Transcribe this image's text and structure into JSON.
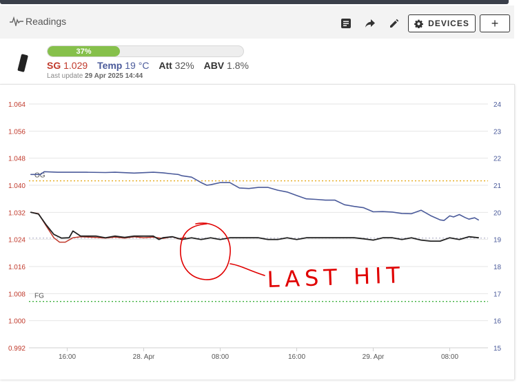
{
  "header": {
    "title": "Readings",
    "devices_label": "DEVICES",
    "add_label": "+",
    "icons": [
      "pulse-icon",
      "notes-icon",
      "share-icon",
      "edit-icon",
      "gear-icon"
    ]
  },
  "device": {
    "progress_label": "37%",
    "progress_fraction": 0.37,
    "sg_label": "SG",
    "sg_value": "1.029",
    "temp_label": "Temp",
    "temp_value": "19 °C",
    "att_label": "Att",
    "att_value": "32%",
    "abv_label": "ABV",
    "abv_value": "1.8%",
    "last_update_label": "Last update",
    "last_update_value": "29 Apr 2025 14:44"
  },
  "colors": {
    "sg": "#c0392b",
    "temp": "#4a5a9a",
    "sg_smoothed": "#222222",
    "og_line": "#e6a817",
    "fg_line": "#3ab03a",
    "current_line": "#b0b0c8",
    "progress": "#86c04b",
    "annotation": "#e00000"
  },
  "chart_data": {
    "type": "line",
    "x_ticks": [
      "16:00",
      "28. Apr",
      "08:00",
      "16:00",
      "29. Apr",
      "08:00"
    ],
    "y_left_ticks": [
      "1.064",
      "1.056",
      "1.048",
      "1.040",
      "1.032",
      "1.024",
      "1.016",
      "1.008",
      "1.000",
      "0.992"
    ],
    "y_right_ticks": [
      "24",
      "23",
      "22",
      "21",
      "20",
      "19",
      "18",
      "17",
      "16",
      "15"
    ],
    "y_left_range": [
      0.992,
      1.064
    ],
    "y_right_range": [
      15,
      24
    ],
    "x_range_hours": [
      -3,
      45
    ],
    "grid": true,
    "og": {
      "label": "OG",
      "value": 1.0413
    },
    "fg": {
      "label": "FG",
      "value": 1.0057
    },
    "current_sg": 1.0244,
    "annotation_text": "LAST HIT",
    "series": [
      {
        "key": "temp",
        "x": [
          -2.8,
          -1.8,
          -1.4,
          0,
          1,
          3,
          5,
          6,
          8,
          10,
          11,
          12,
          12.6,
          13,
          14,
          15,
          15.6,
          16,
          17,
          18,
          19,
          20,
          21,
          22,
          23,
          24,
          25,
          26,
          27,
          28,
          29,
          30,
          31,
          32,
          33,
          34,
          35,
          36,
          37,
          38,
          39,
          40,
          40.4,
          41,
          41.4,
          42,
          42.6,
          43,
          43.6,
          44
        ],
        "y": [
          21.4,
          21.4,
          21.5,
          21.48,
          21.48,
          21.48,
          21.47,
          21.48,
          21.45,
          21.48,
          21.46,
          21.42,
          21.4,
          21.35,
          21.3,
          21.1,
          21.0,
          21.02,
          21.1,
          21.1,
          20.9,
          20.88,
          20.92,
          20.92,
          20.82,
          20.75,
          20.62,
          20.5,
          20.48,
          20.45,
          20.45,
          20.28,
          20.22,
          20.17,
          20.02,
          20.03,
          20.01,
          19.96,
          19.95,
          20.08,
          19.88,
          19.72,
          19.7,
          19.87,
          19.83,
          19.92,
          19.81,
          19.75,
          19.8,
          19.72
        ]
      },
      {
        "key": "sg",
        "x": [
          -2.8,
          -2,
          -1.2,
          -0.4,
          0.2,
          0.8,
          1.6,
          2.4,
          3.2,
          4,
          5,
          6,
          7,
          8,
          9,
          10,
          11,
          12,
          12.6,
          13.4
        ],
        "y": [
          1.032,
          1.0316,
          1.028,
          1.0245,
          1.0232,
          1.0232,
          1.0245,
          1.0248,
          1.0247,
          1.0246,
          1.0244,
          1.0247,
          1.0244,
          1.0248,
          1.0245,
          1.0247,
          1.0243,
          1.0248,
          1.0242,
          1.0246
        ]
      },
      {
        "key": "sg_smoothed",
        "x": [
          -2.8,
          -2,
          -1.2,
          -0.4,
          0.4,
          1.2,
          1.6,
          2.4,
          3.2,
          4,
          5,
          6,
          7,
          8,
          9,
          10,
          10.6,
          11,
          12,
          13,
          14,
          15,
          16,
          17,
          18,
          19,
          20,
          21,
          22,
          23,
          24,
          25,
          26,
          27,
          28,
          29,
          30,
          31,
          32,
          33,
          34,
          35,
          36,
          37,
          38,
          39,
          40,
          41,
          42,
          43,
          44
        ],
        "y": [
          1.032,
          1.0315,
          1.0283,
          1.0255,
          1.0244,
          1.0245,
          1.0265,
          1.025,
          1.025,
          1.025,
          1.0245,
          1.025,
          1.0246,
          1.025,
          1.025,
          1.025,
          1.024,
          1.0245,
          1.0248,
          1.024,
          1.0245,
          1.024,
          1.0245,
          1.024,
          1.0245,
          1.0245,
          1.0245,
          1.0245,
          1.024,
          1.024,
          1.0245,
          1.024,
          1.0245,
          1.0245,
          1.0245,
          1.0245,
          1.0245,
          1.0245,
          1.0242,
          1.0238,
          1.0245,
          1.0245,
          1.024,
          1.0245,
          1.0238,
          1.0235,
          1.0235,
          1.0245,
          1.024,
          1.0248,
          1.0245
        ]
      }
    ]
  }
}
